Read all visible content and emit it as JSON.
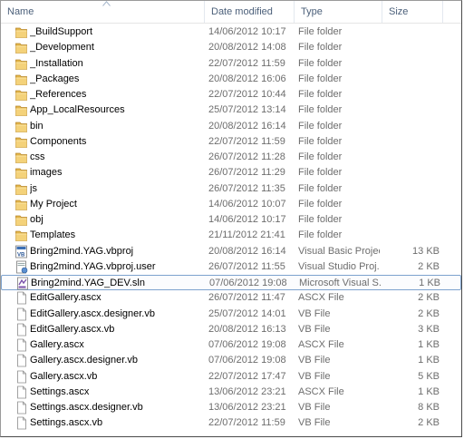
{
  "columns": {
    "name": "Name",
    "date": "Date modified",
    "type": "Type",
    "size": "Size"
  },
  "sort": {
    "column": "name",
    "direction": "ascending",
    "icon": "sort-ascending-icon"
  },
  "rows": [
    {
      "name": "_BuildSupport",
      "date": "14/06/2012 10:17",
      "type": "File folder",
      "size": "",
      "icon": "folder"
    },
    {
      "name": "_Development",
      "date": "20/08/2012 14:08",
      "type": "File folder",
      "size": "",
      "icon": "folder"
    },
    {
      "name": "_Installation",
      "date": "22/07/2012 11:59",
      "type": "File folder",
      "size": "",
      "icon": "folder"
    },
    {
      "name": "_Packages",
      "date": "20/08/2012 16:06",
      "type": "File folder",
      "size": "",
      "icon": "folder"
    },
    {
      "name": "_References",
      "date": "22/07/2012 10:44",
      "type": "File folder",
      "size": "",
      "icon": "folder"
    },
    {
      "name": "App_LocalResources",
      "date": "25/07/2012 13:14",
      "type": "File folder",
      "size": "",
      "icon": "folder"
    },
    {
      "name": "bin",
      "date": "20/08/2012 16:14",
      "type": "File folder",
      "size": "",
      "icon": "folder"
    },
    {
      "name": "Components",
      "date": "22/07/2012 11:59",
      "type": "File folder",
      "size": "",
      "icon": "folder"
    },
    {
      "name": "css",
      "date": "26/07/2012 11:28",
      "type": "File folder",
      "size": "",
      "icon": "folder"
    },
    {
      "name": "images",
      "date": "26/07/2012 11:29",
      "type": "File folder",
      "size": "",
      "icon": "folder"
    },
    {
      "name": "js",
      "date": "26/07/2012 11:35",
      "type": "File folder",
      "size": "",
      "icon": "folder"
    },
    {
      "name": "My Project",
      "date": "14/06/2012 10:07",
      "type": "File folder",
      "size": "",
      "icon": "folder"
    },
    {
      "name": "obj",
      "date": "14/06/2012 10:17",
      "type": "File folder",
      "size": "",
      "icon": "folder"
    },
    {
      "name": "Templates",
      "date": "21/11/2012 21:41",
      "type": "File folder",
      "size": "",
      "icon": "folder"
    },
    {
      "name": "Bring2mind.YAG.vbproj",
      "date": "20/08/2012 16:14",
      "type": "Visual Basic Projec...",
      "size": "13 KB",
      "icon": "vbproj"
    },
    {
      "name": "Bring2mind.YAG.vbproj.user",
      "date": "26/07/2012 11:55",
      "type": "Visual Studio Proj...",
      "size": "2 KB",
      "icon": "vsuser"
    },
    {
      "name": "Bring2mind.YAG_DEV.sln",
      "date": "07/06/2012 19:08",
      "type": "Microsoft Visual S...",
      "size": "1 KB",
      "icon": "sln",
      "focused": true
    },
    {
      "name": "EditGallery.ascx",
      "date": "26/07/2012 11:47",
      "type": "ASCX File",
      "size": "2 KB",
      "icon": "file"
    },
    {
      "name": "EditGallery.ascx.designer.vb",
      "date": "25/07/2012 14:01",
      "type": "VB File",
      "size": "2 KB",
      "icon": "file"
    },
    {
      "name": "EditGallery.ascx.vb",
      "date": "20/08/2012 16:13",
      "type": "VB File",
      "size": "3 KB",
      "icon": "file"
    },
    {
      "name": "Gallery.ascx",
      "date": "07/06/2012 19:08",
      "type": "ASCX File",
      "size": "1 KB",
      "icon": "file"
    },
    {
      "name": "Gallery.ascx.designer.vb",
      "date": "07/06/2012 19:08",
      "type": "VB File",
      "size": "1 KB",
      "icon": "file"
    },
    {
      "name": "Gallery.ascx.vb",
      "date": "22/07/2012 17:47",
      "type": "VB File",
      "size": "5 KB",
      "icon": "file"
    },
    {
      "name": "Settings.ascx",
      "date": "13/06/2012 23:21",
      "type": "ASCX File",
      "size": "1 KB",
      "icon": "file"
    },
    {
      "name": "Settings.ascx.designer.vb",
      "date": "13/06/2012 23:21",
      "type": "VB File",
      "size": "8 KB",
      "icon": "file"
    },
    {
      "name": "Settings.ascx.vb",
      "date": "22/07/2012 11:59",
      "type": "VB File",
      "size": "2 KB",
      "icon": "file"
    }
  ]
}
